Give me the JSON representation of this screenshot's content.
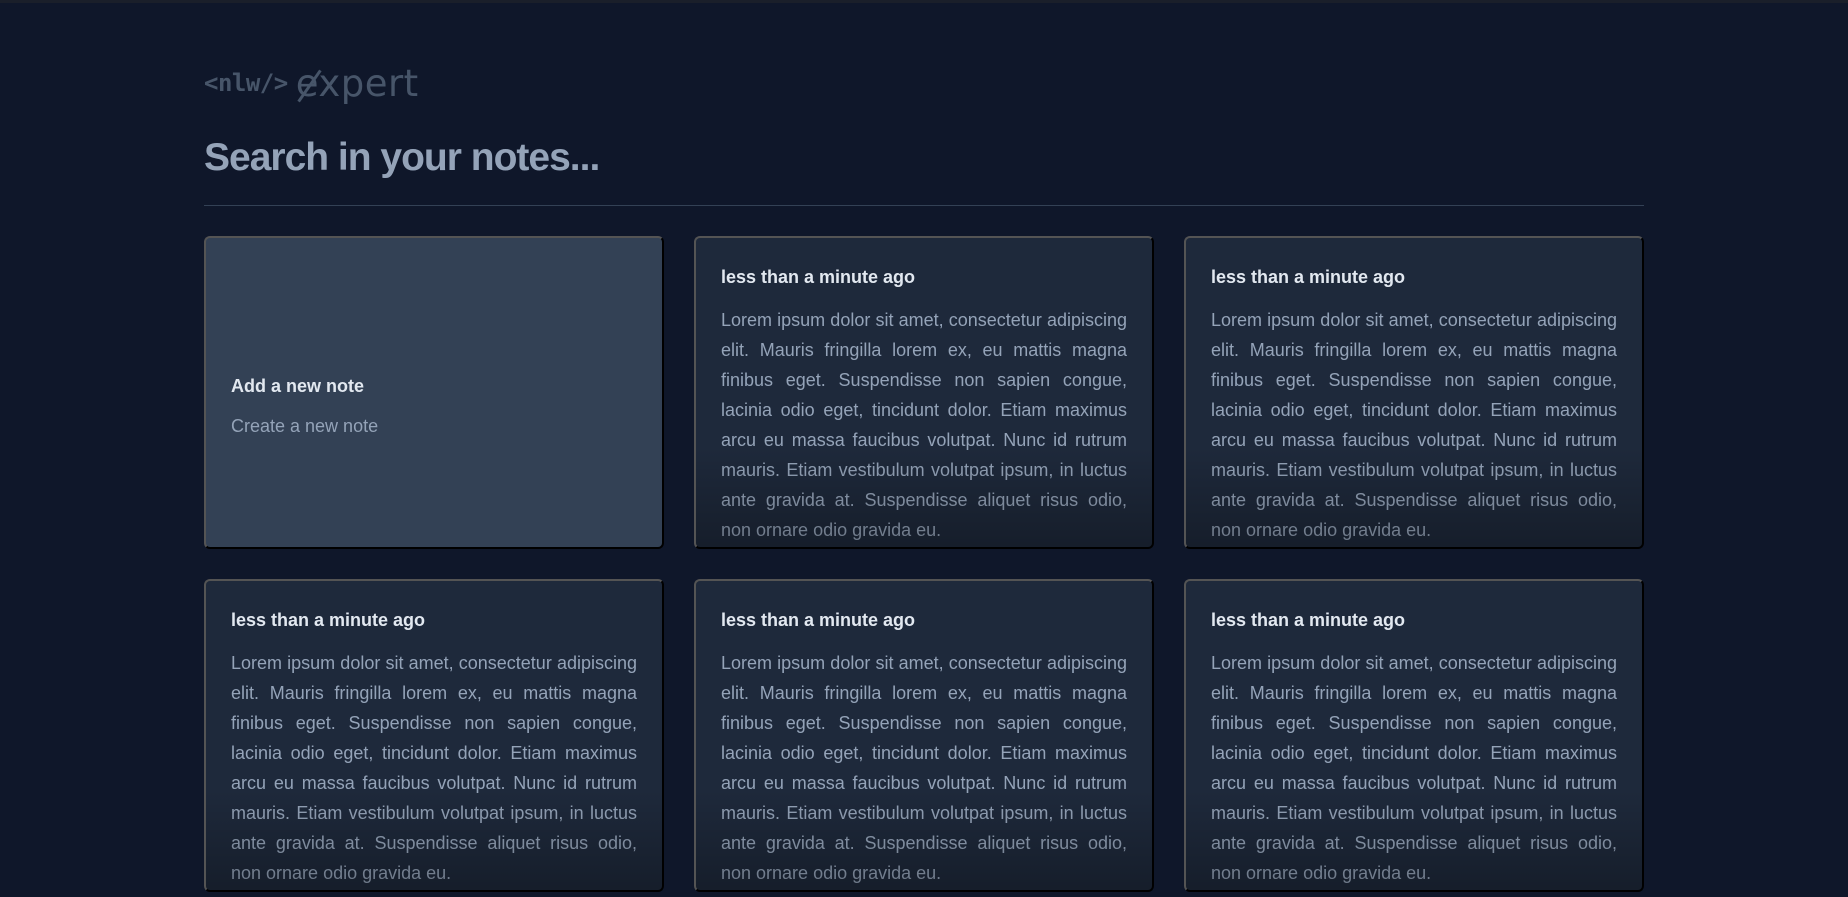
{
  "header": {
    "logo_tag": "<nlw/>",
    "logo_word": "expert"
  },
  "search": {
    "placeholder": "Search in your notes..."
  },
  "add_card": {
    "title": "Add a new note",
    "subtitle": "Create a new note"
  },
  "notes": [
    {
      "date": "less than a minute ago",
      "content": "Lorem ipsum dolor sit amet, consectetur adipiscing elit. Mauris fringilla lorem ex, eu mattis magna finibus eget. Suspendisse non sapien congue, lacinia odio eget, tincidunt dolor. Etiam maximus arcu eu massa faucibus volutpat. Nunc id rutrum mauris. Etiam vestibulum volutpat ipsum, in luctus ante gravida at. Suspendisse aliquet risus odio, non ornare odio gravida eu."
    },
    {
      "date": "less than a minute ago",
      "content": "Lorem ipsum dolor sit amet, consectetur adipiscing elit. Mauris fringilla lorem ex, eu mattis magna finibus eget. Suspendisse non sapien congue, lacinia odio eget, tincidunt dolor. Etiam maximus arcu eu massa faucibus volutpat. Nunc id rutrum mauris. Etiam vestibulum volutpat ipsum, in luctus ante gravida at. Suspendisse aliquet risus odio, non ornare odio gravida eu."
    },
    {
      "date": "less than a minute ago",
      "content": "Lorem ipsum dolor sit amet, consectetur adipiscing elit. Mauris fringilla lorem ex, eu mattis magna finibus eget. Suspendisse non sapien congue, lacinia odio eget, tincidunt dolor. Etiam maximus arcu eu massa faucibus volutpat. Nunc id rutrum mauris. Etiam vestibulum volutpat ipsum, in luctus ante gravida at. Suspendisse aliquet risus odio, non ornare odio gravida eu."
    },
    {
      "date": "less than a minute ago",
      "content": "Lorem ipsum dolor sit amet, consectetur adipiscing elit. Mauris fringilla lorem ex, eu mattis magna finibus eget. Suspendisse non sapien congue, lacinia odio eget, tincidunt dolor. Etiam maximus arcu eu massa faucibus volutpat. Nunc id rutrum mauris. Etiam vestibulum volutpat ipsum, in luctus ante gravida at. Suspendisse aliquet risus odio, non ornare odio gravida eu."
    },
    {
      "date": "less than a minute ago",
      "content": "Lorem ipsum dolor sit amet, consectetur adipiscing elit. Mauris fringilla lorem ex, eu mattis magna finibus eget. Suspendisse non sapien congue, lacinia odio eget, tincidunt dolor. Etiam maximus arcu eu massa faucibus volutpat. Nunc id rutrum mauris. Etiam vestibulum volutpat ipsum, in luctus ante gravida at. Suspendisse aliquet risus odio, non ornare odio gravida eu."
    }
  ],
  "colors": {
    "background": "#0f172a",
    "card": "#1e293b",
    "add_card": "#334155",
    "title_text": "#e2e8f0",
    "body_text": "#94a3b8",
    "logo": "#475569"
  }
}
